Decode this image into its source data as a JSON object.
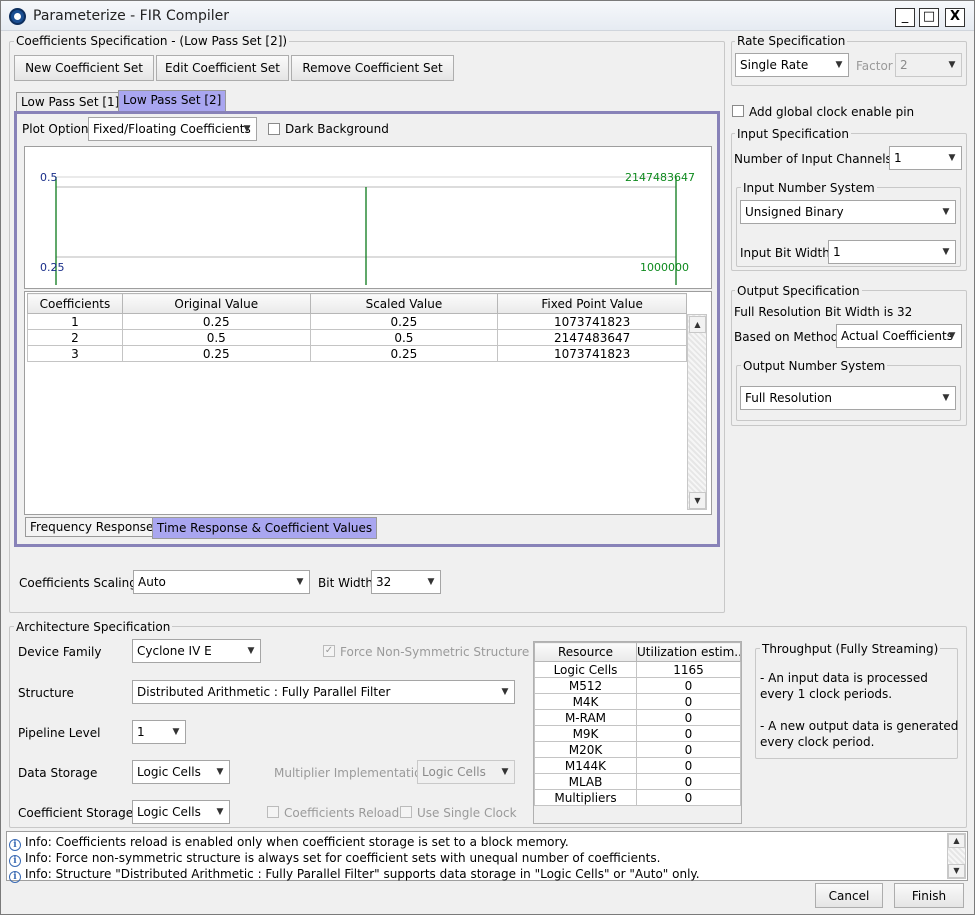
{
  "window": {
    "title": "Parameterize - FIR Compiler",
    "minimize": "_",
    "maximize": "□",
    "close": "X"
  },
  "coef_spec": {
    "title": "Coefficients Specification - (Low Pass Set [2])",
    "new_btn": "New Coefficient Set",
    "edit_btn": "Edit Coefficient Set",
    "remove_btn": "Remove Coefficient Set",
    "set_tabs": [
      "Low Pass Set [1]",
      "Low Pass Set [2]"
    ],
    "plot_option_label": "Plot Option",
    "plot_option_value": "Fixed/Floating Coefficients",
    "dark_bg_label": "Dark Background",
    "dark_bg_checked": false,
    "plot": {
      "left_top": "0.5",
      "left_bottom": "0.25",
      "right_top": "2147483647",
      "right_bottom": "1000000",
      "colors": {
        "left_axis": "#1a2f8a",
        "right_axis": "#0e8a1e",
        "stems": "#0a7a1a"
      }
    },
    "table": {
      "headers": [
        "Coefficients",
        "Original Value",
        "Scaled Value",
        "Fixed Point Value"
      ],
      "rows": [
        [
          "1",
          "0.25",
          "0.25",
          "1073741823"
        ],
        [
          "2",
          "0.5",
          "0.5",
          "2147483647"
        ],
        [
          "3",
          "0.25",
          "0.25",
          "1073741823"
        ]
      ]
    },
    "bottom_tabs": [
      "Frequency Response",
      "Time Response & Coefficient Values"
    ],
    "scaling_label": "Coefficients Scaling",
    "scaling_value": "Auto",
    "bitwidth_label": "Bit Width",
    "bitwidth_value": "32"
  },
  "rate": {
    "title": "Rate Specification",
    "value": "Single Rate",
    "factor_label": "Factor",
    "factor_value": "2"
  },
  "global_clock": {
    "label": "Add global clock enable pin",
    "checked": false
  },
  "input_spec": {
    "title": "Input Specification",
    "channels_label": "Number of Input Channels",
    "channels_value": "1",
    "number_system_title": "Input Number System",
    "number_system_value": "Unsigned Binary",
    "bitwidth_label": "Input Bit Width",
    "bitwidth_value": "1"
  },
  "output_spec": {
    "title": "Output Specification",
    "full_res_text": "Full Resolution Bit Width is 32",
    "method_label": "Based on Method",
    "method_value": "Actual Coefficients",
    "number_system_title": "Output Number System",
    "number_system_value": "Full Resolution"
  },
  "arch": {
    "title": "Architecture Specification",
    "device_family_label": "Device Family",
    "device_family_value": "Cyclone IV E",
    "force_nonsym_label": "Force Non-Symmetric Structure",
    "structure_label": "Structure",
    "structure_value": "Distributed Arithmetic : Fully Parallel Filter",
    "pipeline_label": "Pipeline Level",
    "pipeline_value": "1",
    "data_storage_label": "Data Storage",
    "data_storage_value": "Logic Cells",
    "mult_impl_label": "Multiplier Implementation",
    "mult_impl_value": "Logic Cells",
    "coef_storage_label": "Coefficient Storage",
    "coef_storage_value": "Logic Cells",
    "coef_reload_label": "Coefficients Reload",
    "single_clock_label": "Use Single Clock",
    "resources": {
      "headers": [
        "Resource",
        "Utilization estim..."
      ],
      "rows": [
        [
          "Logic Cells",
          "1165"
        ],
        [
          "M512",
          "0"
        ],
        [
          "M4K",
          "0"
        ],
        [
          "M-RAM",
          "0"
        ],
        [
          "M9K",
          "0"
        ],
        [
          "M20K",
          "0"
        ],
        [
          "M144K",
          "0"
        ],
        [
          "MLAB",
          "0"
        ],
        [
          "Multipliers",
          "0"
        ]
      ]
    },
    "throughput": {
      "title": "Throughput (Fully Streaming)",
      "line1": "- An input data is processed",
      "line2": "every 1 clock periods.",
      "line3": "- A new output data is generated",
      "line4": "every clock period."
    }
  },
  "messages": [
    "Info: Coefficients reload is enabled only when coefficient storage is set to a block memory.",
    "Info: Force non-symmetric structure is always set for coefficient sets with unequal number of coefficients.",
    "Info: Structure \"Distributed Arithmetic : Fully Parallel Filter\" supports data storage in \"Logic Cells\" or \"Auto\" only."
  ],
  "footer": {
    "cancel": "Cancel",
    "finish": "Finish"
  }
}
